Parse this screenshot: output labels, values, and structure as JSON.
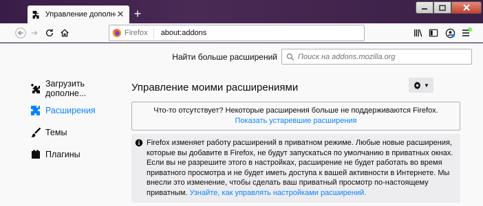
{
  "tab": {
    "title": "Управление дополнениями"
  },
  "urlbar": {
    "identity": "Firefox",
    "url": "about:addons"
  },
  "search": {
    "label": "Найти больше расширений",
    "placeholder": "Поиск на addons.mozilla.org"
  },
  "sidebar": {
    "items": [
      {
        "label": "Загрузить дополне...",
        "icon": "get-addons-icon"
      },
      {
        "label": "Расширения",
        "icon": "puzzle-icon",
        "active": true
      },
      {
        "label": "Темы",
        "icon": "brush-icon"
      },
      {
        "label": "Плагины",
        "icon": "plugin-icon"
      }
    ]
  },
  "main": {
    "title": "Управление моими расширениями",
    "legacy_notice": "Что-то отсутствует? Некоторые расширения больше не поддерживаются Firefox.",
    "legacy_link": "Показать устаревшие расширения",
    "private_notice": "Firefox изменяет работу расширений в приватном режиме. Любые новые расширения, которые вы добавите в Firefox, не будут запускаться по умолчанию в приватных окнах. Если вы не разрешите этого в настройках, расширение не будет работать во время приватного просмотра и не будет иметь доступа к вашей активности в Интернете. Мы внесли это изменение, чтобы сделать ваш приватный просмотр по-настоящему приватным.",
    "private_link": "Узнайте, как управлять настройками расширений."
  },
  "colors": {
    "accent": "#0a84ff",
    "frame": "#3a1c48"
  }
}
